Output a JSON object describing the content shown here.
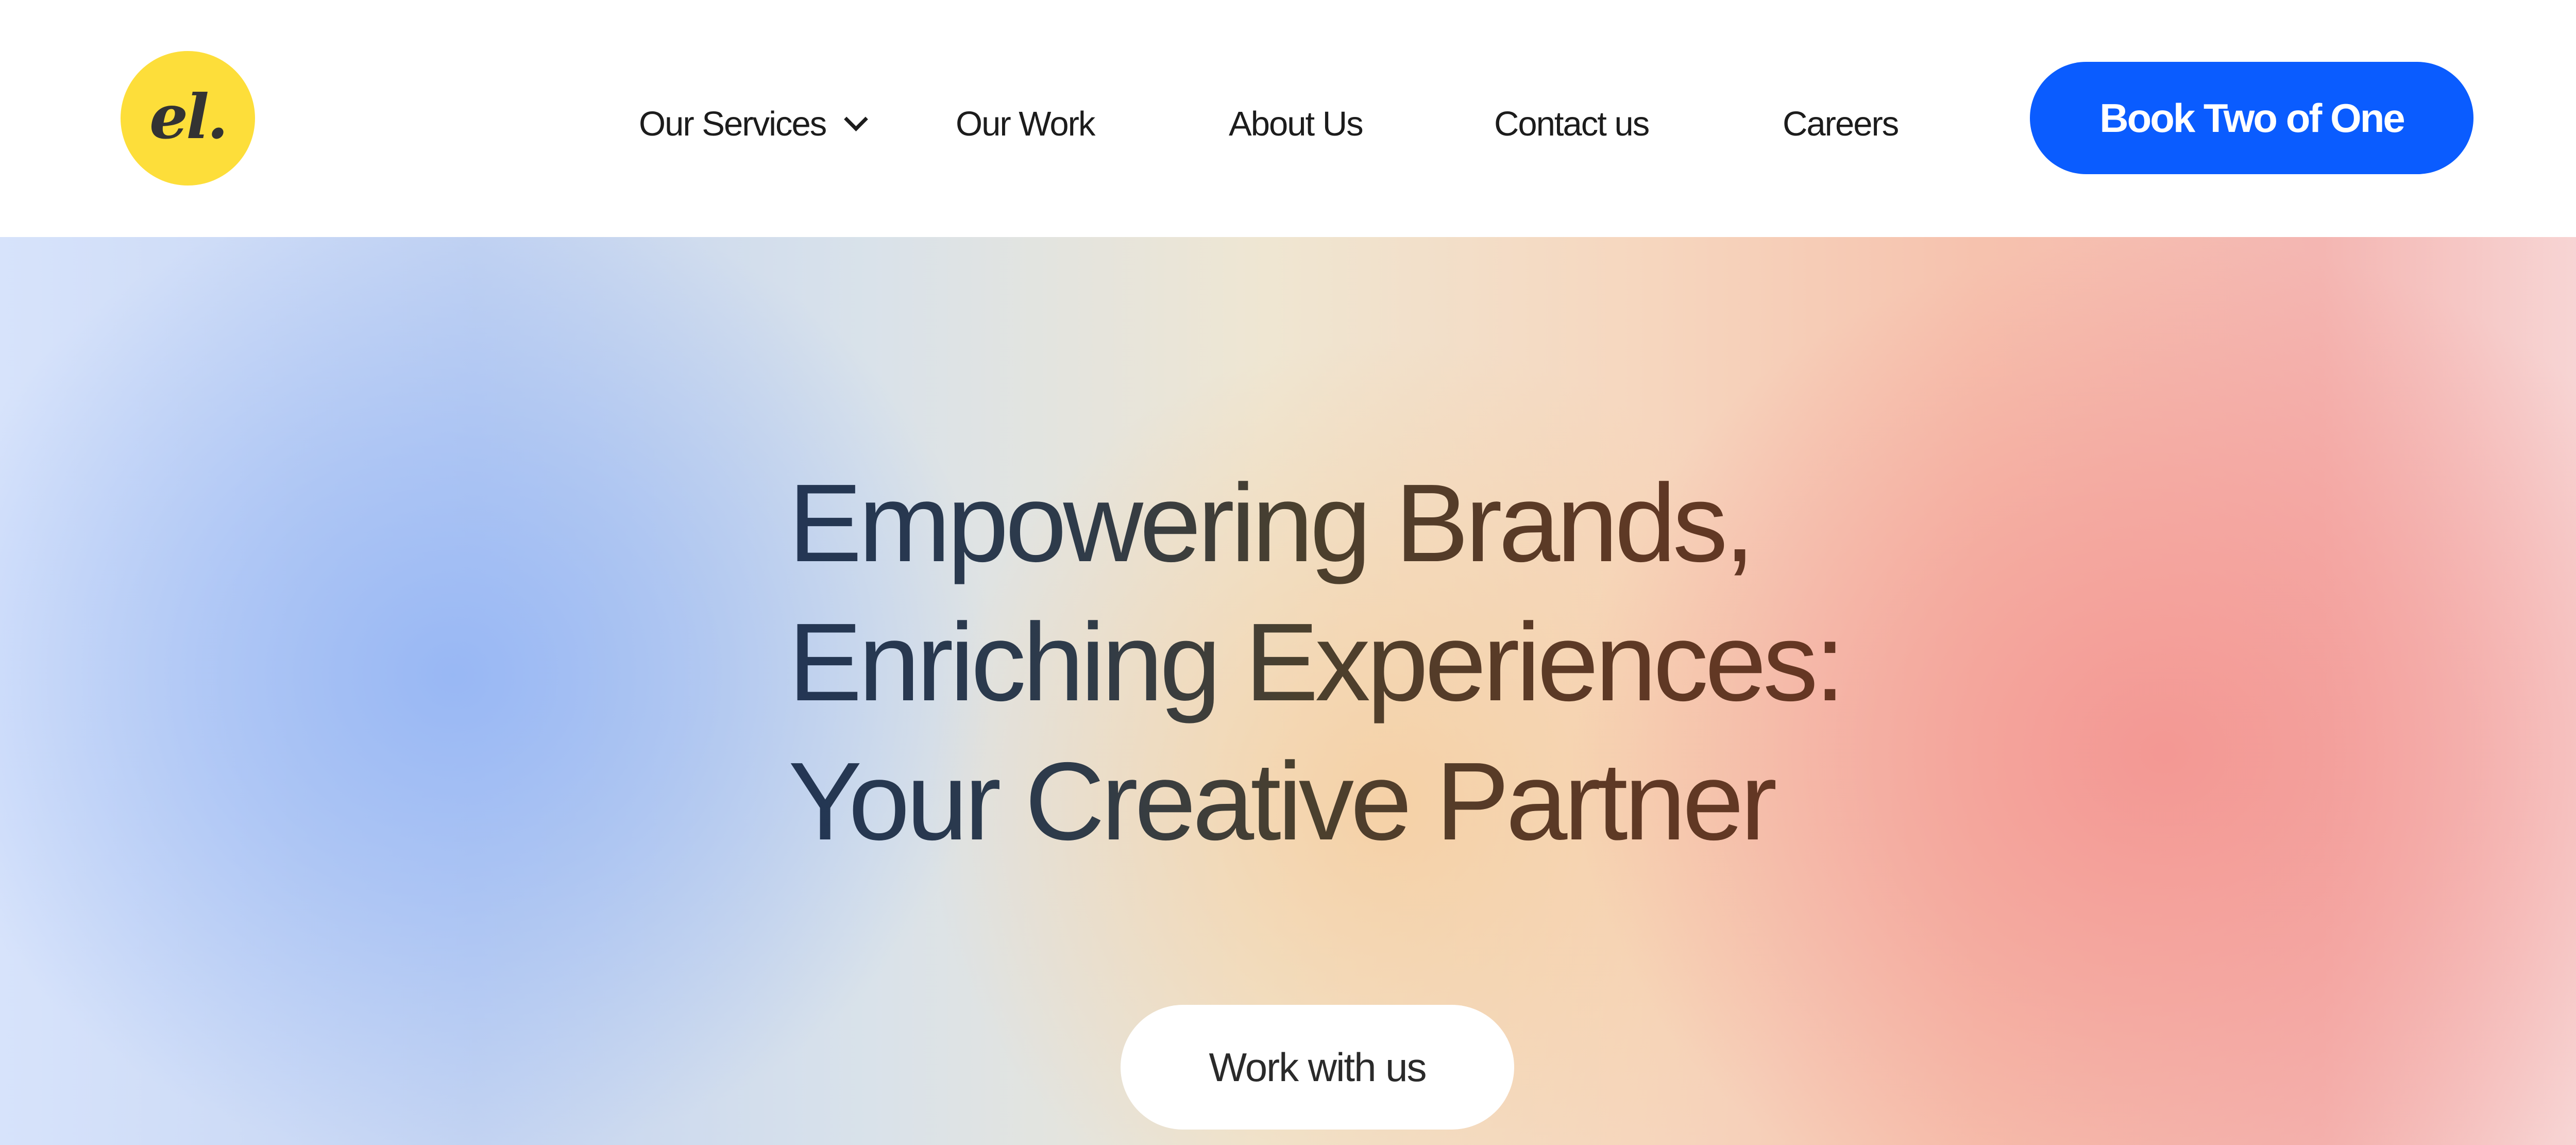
{
  "logo": {
    "text": "el.",
    "bg_color": "#fdde3a",
    "text_color": "#333333"
  },
  "nav": {
    "text_color": "#1c1c1c",
    "items": [
      {
        "label": "Our Services",
        "has_dropdown": true,
        "icon": "chevron-down-icon"
      },
      {
        "label": "Our Work"
      },
      {
        "label": "About Us"
      },
      {
        "label": "Contact us"
      },
      {
        "label": "Careers"
      }
    ]
  },
  "header_cta": {
    "label": "Book Two of One",
    "bg_color": "#0a5cff",
    "text_color": "#ffffff"
  },
  "hero": {
    "headline_lines": [
      "Empowering Brands,",
      "Enriching Experiences:",
      "Your Creative Partner"
    ],
    "cta_label": "Work with us",
    "cta_text_color": "#2a2a2a"
  }
}
